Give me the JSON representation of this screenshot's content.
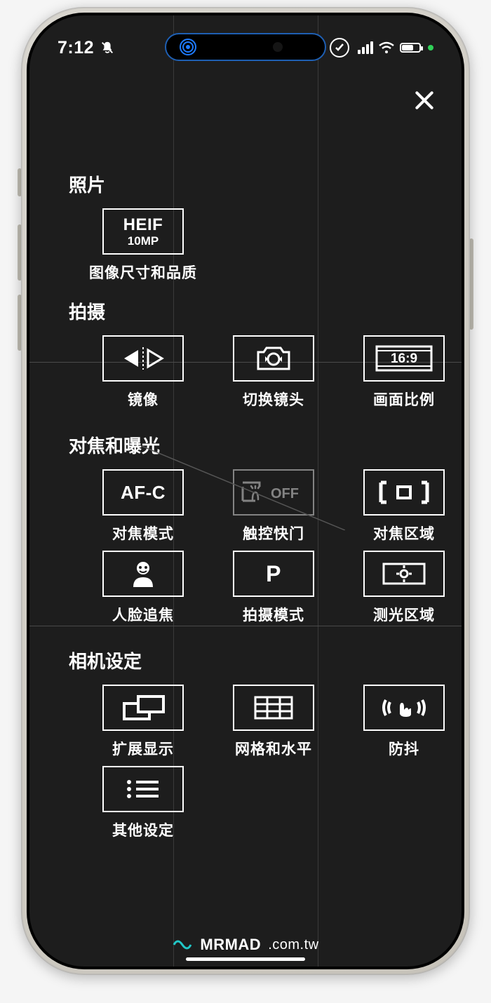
{
  "status": {
    "time": "7:12"
  },
  "close": "×",
  "sections": {
    "photo": {
      "title": "照片",
      "image_quality": {
        "line1": "HEIF",
        "line2": "10MP",
        "label": "图像尺寸和品质"
      }
    },
    "capture": {
      "title": "拍摄",
      "mirror": {
        "label": "镜像"
      },
      "switch_lens": {
        "label": "切换镜头"
      },
      "aspect": {
        "badge": "16:9",
        "label": "画面比例"
      }
    },
    "focus": {
      "title": "对焦和曝光",
      "af_mode": {
        "badge": "AF-C",
        "label": "对焦模式"
      },
      "touch": {
        "badge": "OFF",
        "label": "触控快门"
      },
      "focus_area": {
        "label": "对焦区域"
      },
      "face": {
        "label": "人脸追焦"
      },
      "shoot_mode": {
        "badge": "P",
        "label": "拍摄模式"
      },
      "meter": {
        "label": "测光区域"
      }
    },
    "camera": {
      "title": "相机设定",
      "ext_display": {
        "label": "扩展显示"
      },
      "grid_level": {
        "label": "网格和水平"
      },
      "stab": {
        "label": "防抖"
      },
      "other": {
        "label": "其他设定"
      }
    }
  },
  "watermark": {
    "brand": "MRMAD",
    "suffix": ".com.tw"
  }
}
